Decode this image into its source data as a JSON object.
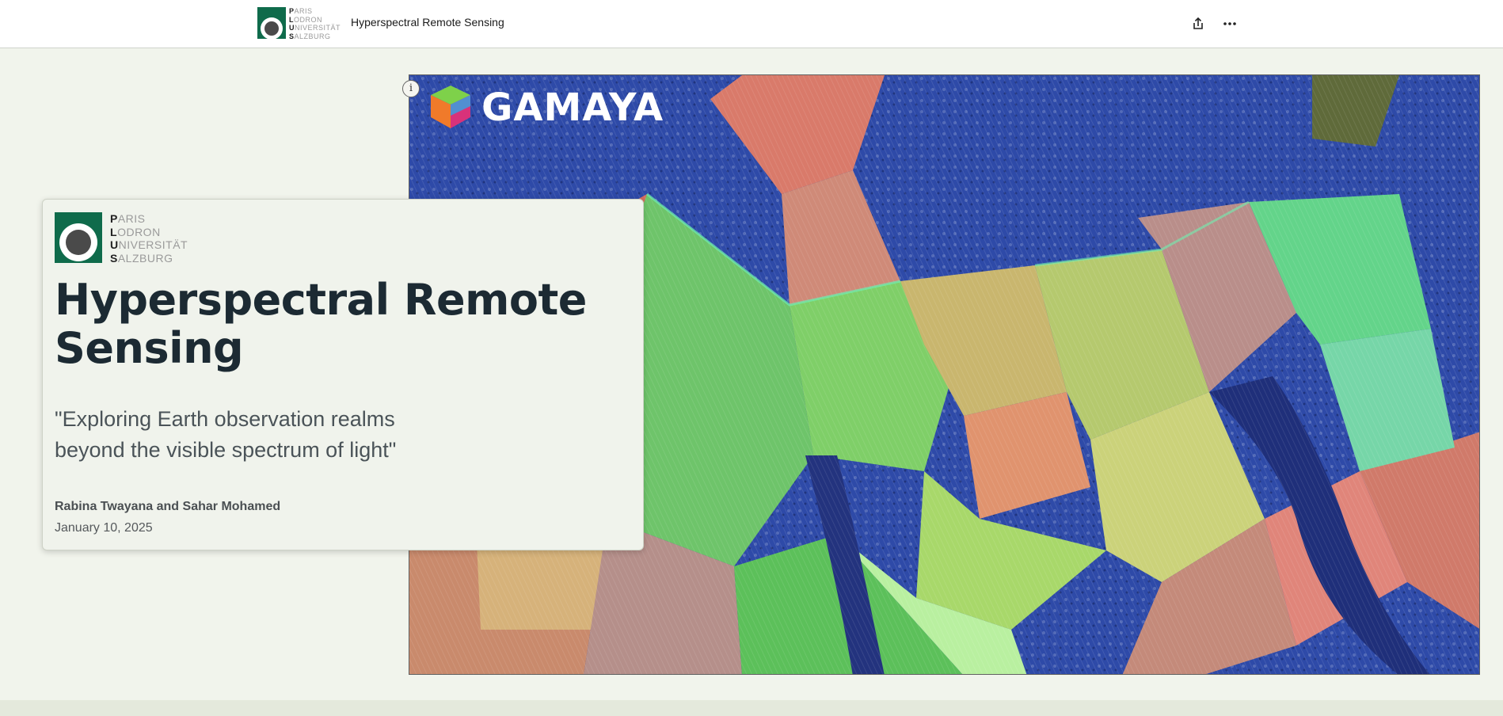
{
  "header": {
    "logo": {
      "lines": [
        {
          "initial": "P",
          "rest": "ARIS"
        },
        {
          "initial": "L",
          "rest": "ODRON"
        },
        {
          "initial": "U",
          "rest": "NIVERSITÄT"
        },
        {
          "initial": "S",
          "rest": "ALZBURG"
        }
      ]
    },
    "title": "Hyperspectral Remote Sensing",
    "share_icon": "share-icon",
    "more_icon": "more-horizontal-icon"
  },
  "hero": {
    "info_label": "i",
    "watermark": "GAMAYA"
  },
  "card": {
    "title": "Hyperspectral Remote Sensing",
    "subtitle": "\"Exploring Earth observation realms beyond the visible spectrum of light\"",
    "authors": "Rabina Twayana and Sahar Mohamed",
    "date": "January 10, 2025"
  },
  "colors": {
    "brand_green": "#0f6b4b",
    "page_bg": "#f1f4ec",
    "title_color": "#1c2a33"
  }
}
